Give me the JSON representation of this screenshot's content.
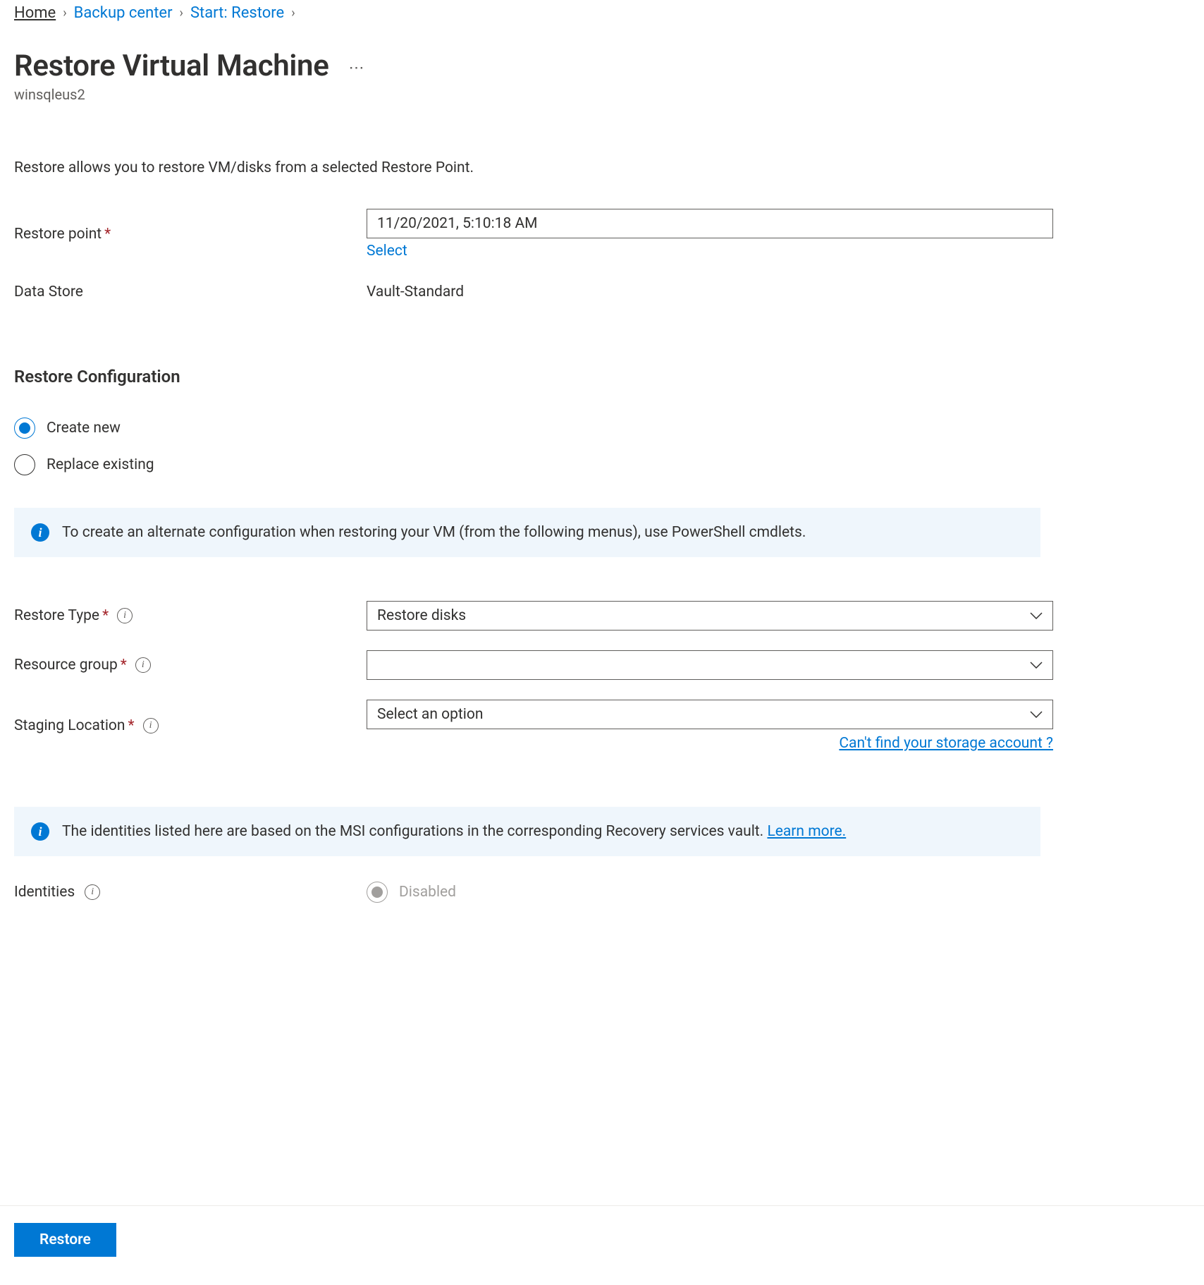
{
  "breadcrumb": {
    "home": "Home",
    "backup_center": "Backup center",
    "start_restore": "Start: Restore"
  },
  "title": "Restore Virtual Machine",
  "subtitle": "winsqleus2",
  "description": "Restore allows you to restore VM/disks from a selected Restore Point.",
  "labels": {
    "restore_point": "Restore point",
    "data_store": "Data Store",
    "restore_configuration": "Restore Configuration",
    "restore_type": "Restore Type",
    "resource_group": "Resource group",
    "staging_location": "Staging Location",
    "identities": "Identities"
  },
  "restore_point": {
    "value": "11/20/2021, 5:10:18 AM",
    "select_link": "Select"
  },
  "data_store_value": "Vault-Standard",
  "radio": {
    "create_new": "Create new",
    "replace_existing": "Replace existing"
  },
  "banners": {
    "alt_config": "To create an alternate configuration when restoring your VM (from the following menus), use PowerShell cmdlets.",
    "identities_pre": "The identities listed here are based on the MSI configurations in the corresponding Recovery services vault. ",
    "identities_link": "Learn more."
  },
  "dropdowns": {
    "restore_type_value": "Restore disks",
    "resource_group_value": "",
    "staging_location_placeholder": "Select an option"
  },
  "help": {
    "storage_account": "Can't find your storage account ?"
  },
  "identities": {
    "disabled": "Disabled"
  },
  "buttons": {
    "restore": "Restore"
  }
}
